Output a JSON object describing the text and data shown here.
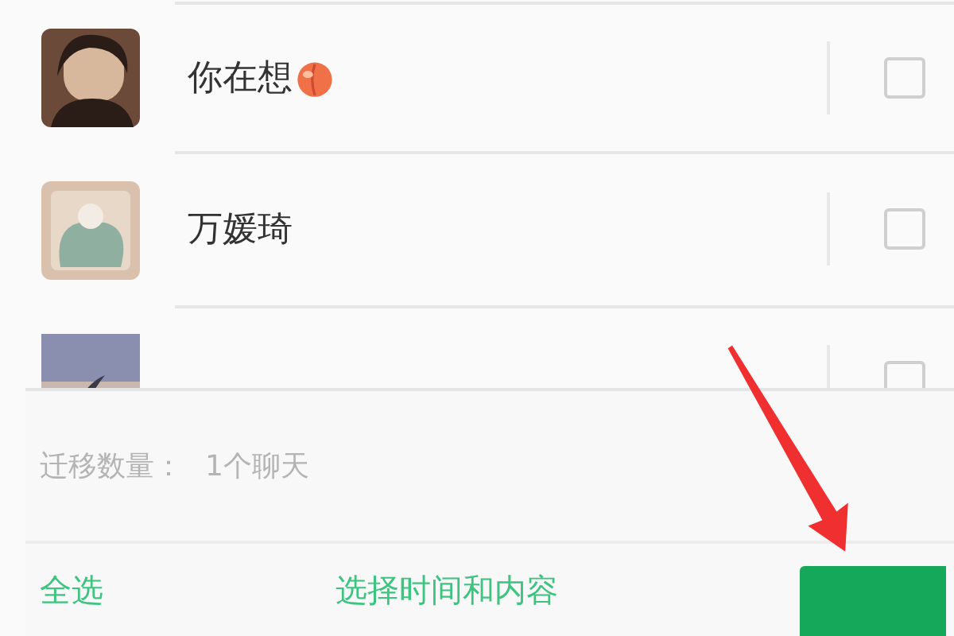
{
  "chats": [
    {
      "kind": "emoji",
      "name": "你在想",
      "checked": false
    },
    {
      "kind": "plain",
      "name": "万媛琦",
      "checked": false
    },
    {
      "kind": "plain",
      "checked": false
    }
  ],
  "migration": {
    "label": "迁移数量：",
    "value": "1个聊天"
  },
  "footer": {
    "select_all": "全选",
    "select_time": "选择时间和内容"
  }
}
